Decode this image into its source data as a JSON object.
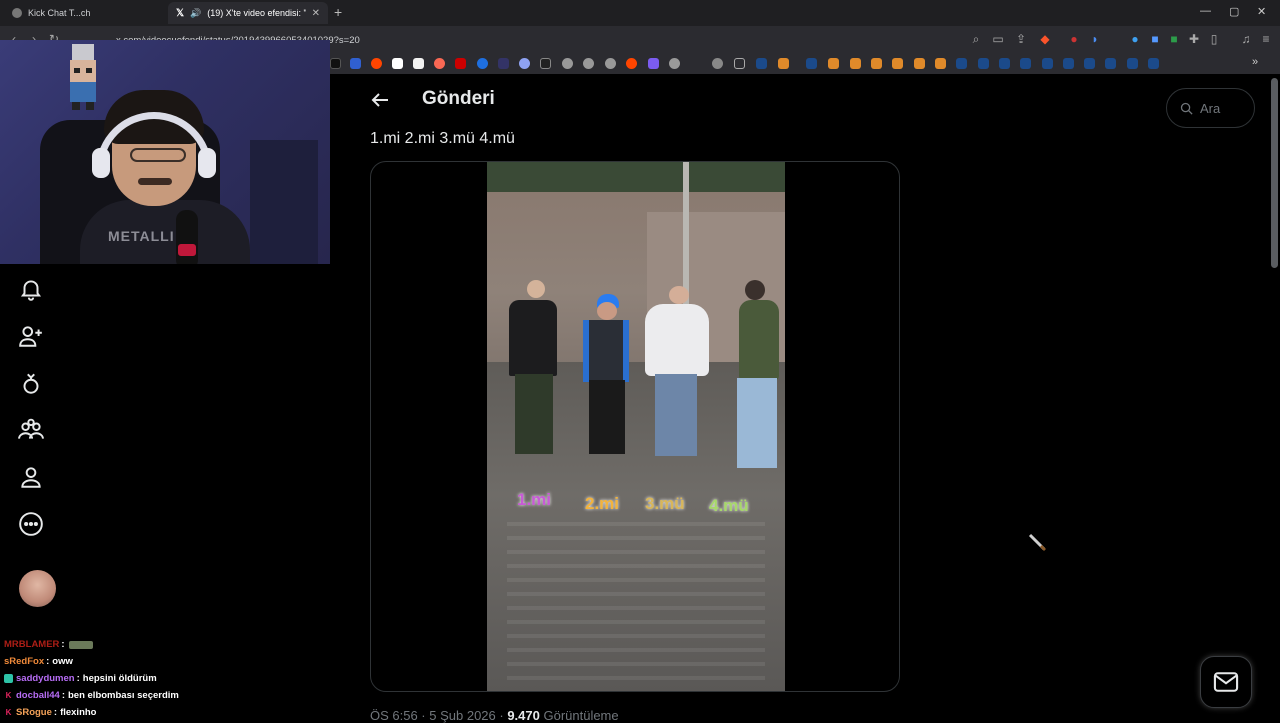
{
  "browser": {
    "tabs": [
      {
        "label": "Kick Chat T...ch",
        "active": false
      },
      {
        "label": "(19) X'te video efendisi: \"1.mi",
        "active": true
      }
    ],
    "url": "x.com/videocuefendi/status/2019439966053401029?s=20",
    "window_controls": [
      "—",
      "▢",
      "✕"
    ]
  },
  "webcam": {
    "shirt_text": "METALLI"
  },
  "sidebar": {
    "icons": [
      "bell-icon",
      "add-user-icon",
      "premium-icon",
      "communities-icon",
      "profile-icon",
      "more-icon"
    ]
  },
  "chat": {
    "messages": [
      {
        "user": "MRBLAMER",
        "text": "",
        "color": "#d9261c"
      },
      {
        "user": "sRedFox",
        "text": "oww",
        "color": "#f08a3a"
      },
      {
        "user": "saddydumen",
        "text": "hepsini öldürüm",
        "color": "#b76df5"
      },
      {
        "user": "docball44",
        "text": "ben elbombası seçerdim",
        "color": "#b76df5"
      },
      {
        "user": "SRogue",
        "text": "flexinho",
        "color": "#f4a259"
      }
    ]
  },
  "post": {
    "header_title": "Gönderi",
    "text": "1.mi 2.mi 3.mü 4.mü",
    "video_labels": [
      {
        "text": "1.mi",
        "color": "#c85bd6"
      },
      {
        "text": "2.mi",
        "color": "#f2b33d"
      },
      {
        "text": "3.mü",
        "color": "#d8b65a"
      },
      {
        "text": "4.mü",
        "color": "#a7d86a"
      }
    ],
    "time": "ÖS 6:56 · 5 Şub 2026 · ",
    "views": "9.470",
    "views_label": " Görüntüleme"
  },
  "search": {
    "placeholder": "Ara"
  },
  "colors": {
    "background": "#000000",
    "border": "#2f3336",
    "muted": "#71767b",
    "text": "#e7e9ea"
  }
}
